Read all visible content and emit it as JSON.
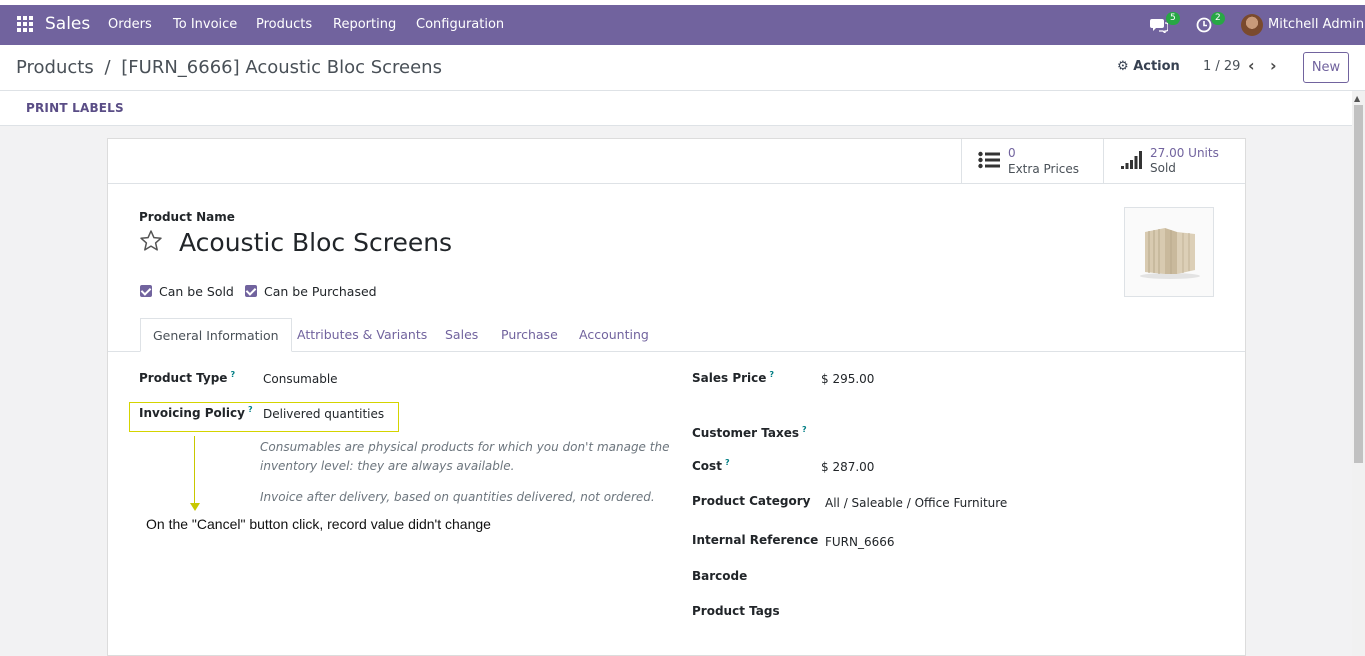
{
  "navbar": {
    "app_name": "Sales",
    "menu": [
      "Orders",
      "To Invoice",
      "Products",
      "Reporting",
      "Configuration"
    ],
    "messages_count": "5",
    "activities_count": "2",
    "user_name": "Mitchell Admin"
  },
  "control_panel": {
    "breadcrumb_root": "Products",
    "breadcrumb_sep": "/",
    "breadcrumb_current": "[FURN_6666] Acoustic Bloc Screens",
    "action_label": "Action",
    "pager": "1 / 29",
    "new_label": "New"
  },
  "statusbar": {
    "print_labels": "PRINT LABELS"
  },
  "smart_buttons": {
    "extra_prices_value": "0",
    "extra_prices_label": "Extra Prices",
    "sold_value": "27.00 Units",
    "sold_label": "Sold"
  },
  "product": {
    "name_label": "Product Name",
    "name": "Acoustic Bloc Screens",
    "can_be_sold": "Can be Sold",
    "can_be_purchased": "Can be Purchased"
  },
  "tabs": [
    "General Information",
    "Attributes & Variants",
    "Sales",
    "Purchase",
    "Accounting"
  ],
  "left_fields": {
    "product_type_label": "Product Type",
    "product_type_value": "Consumable",
    "invoicing_policy_label": "Invoicing Policy",
    "invoicing_policy_value": "Delivered quantities",
    "help_consumable_1": "Consumables are physical products for which you don't manage the",
    "help_consumable_2": "inventory level: they are always available.",
    "help_invoice": "Invoice after delivery, based on quantities delivered, not ordered."
  },
  "right_fields": {
    "sales_price_label": "Sales Price",
    "sales_price_value": "$ 295.00",
    "customer_taxes_label": "Customer Taxes",
    "cost_label": "Cost",
    "cost_value": "$ 287.00",
    "product_category_label": "Product Category",
    "product_category_value": "All / Saleable / Office Furniture",
    "internal_reference_label": "Internal Reference",
    "internal_reference_value": "FURN_6666",
    "barcode_label": "Barcode",
    "product_tags_label": "Product Tags"
  },
  "annotation": "On the \"Cancel\" button click, record value didn't change",
  "colors": {
    "brand": "#71639e",
    "highlight": "#d4d400"
  }
}
